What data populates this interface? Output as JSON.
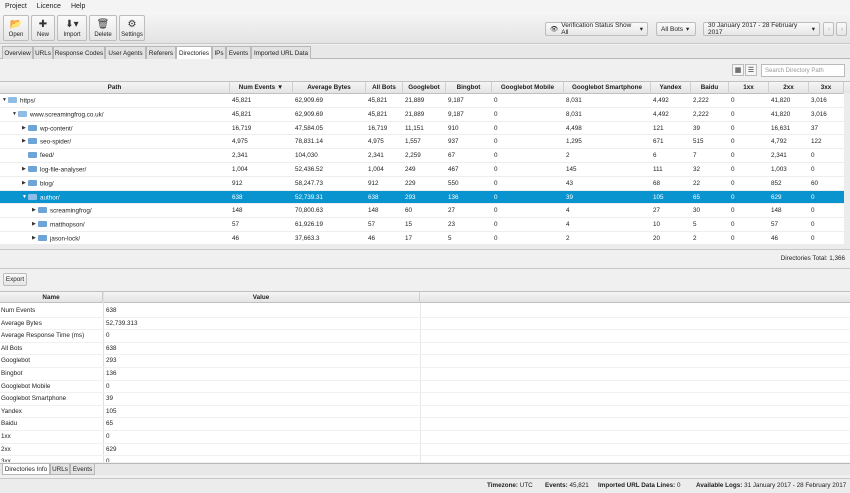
{
  "menu": [
    "Project",
    "Licence",
    "Help"
  ],
  "toolbar": {
    "open": "Open",
    "new": "New",
    "import": "Import",
    "delete": "Delete",
    "settings": "Settings",
    "verification": "Verification Status Show All",
    "bots": "All Bots",
    "daterange": "30 January 2017 - 28 February 2017"
  },
  "tabs": [
    "Overview",
    "URLs",
    "Response Codes",
    "User Agents",
    "Referers",
    "Directories",
    "IPs",
    "Events",
    "Imported URL Data"
  ],
  "search_placeholder": "Search Directory Path",
  "columns": [
    "Path",
    "Num Events",
    "Average Bytes",
    "All Bots",
    "Googlebot",
    "Bingbot",
    "Googlebot Mobile",
    "Googlebot Smartphone",
    "Yandex",
    "Baidu",
    "1xx",
    "2xx",
    "3xx"
  ],
  "rows": [
    {
      "path": "https/",
      "v": [
        "45,821",
        "62,909.69",
        "45,821",
        "21,889",
        "9,187",
        "0",
        "8,031",
        "4,492",
        "2,222",
        "0",
        "41,820",
        "3,016"
      ]
    },
    {
      "path": "www.screamingfrog.co.uk/",
      "v": [
        "45,821",
        "62,909.69",
        "45,821",
        "21,889",
        "9,187",
        "0",
        "8,031",
        "4,492",
        "2,222",
        "0",
        "41,820",
        "3,016"
      ]
    },
    {
      "path": "wp-content/",
      "v": [
        "16,719",
        "47,584.05",
        "16,719",
        "11,151",
        "910",
        "0",
        "4,498",
        "121",
        "39",
        "0",
        "16,631",
        "37"
      ]
    },
    {
      "path": "seo-spider/",
      "v": [
        "4,975",
        "78,831.14",
        "4,975",
        "1,557",
        "937",
        "0",
        "1,295",
        "671",
        "515",
        "0",
        "4,792",
        "122"
      ]
    },
    {
      "path": "feed/",
      "v": [
        "2,341",
        "104,030",
        "2,341",
        "2,259",
        "67",
        "0",
        "2",
        "6",
        "7",
        "0",
        "2,341",
        "0"
      ]
    },
    {
      "path": "log-file-analyser/",
      "v": [
        "1,004",
        "52,436.52",
        "1,004",
        "249",
        "467",
        "0",
        "145",
        "111",
        "32",
        "0",
        "1,003",
        "0"
      ]
    },
    {
      "path": "blog/",
      "v": [
        "912",
        "58,247.73",
        "912",
        "229",
        "550",
        "0",
        "43",
        "68",
        "22",
        "0",
        "852",
        "60"
      ]
    },
    {
      "path": "author/",
      "v": [
        "638",
        "52,739.31",
        "638",
        "293",
        "136",
        "0",
        "39",
        "105",
        "65",
        "0",
        "629",
        "0"
      ]
    },
    {
      "path": "screamingfrog/",
      "v": [
        "148",
        "70,800.63",
        "148",
        "60",
        "27",
        "0",
        "4",
        "27",
        "30",
        "0",
        "148",
        "0"
      ]
    },
    {
      "path": "matthopson/",
      "v": [
        "57",
        "61,926.19",
        "57",
        "15",
        "23",
        "0",
        "4",
        "10",
        "5",
        "0",
        "57",
        "0"
      ]
    },
    {
      "path": "jason-lock/",
      "v": [
        "46",
        "37,663.3",
        "46",
        "17",
        "5",
        "0",
        "2",
        "20",
        "2",
        "0",
        "46",
        "0"
      ]
    }
  ],
  "directories_total": "Directories Total: 1,366",
  "export_label": "Export",
  "detail": {
    "headers": [
      "Name",
      "Value"
    ],
    "rows": [
      {
        "k": "Num Events",
        "v": "638"
      },
      {
        "k": "Average Bytes",
        "v": "52,739.313"
      },
      {
        "k": "Average Response Time (ms)",
        "v": "0"
      },
      {
        "k": "All Bots",
        "v": "638"
      },
      {
        "k": "Googlebot",
        "v": "293"
      },
      {
        "k": "Bingbot",
        "v": "136"
      },
      {
        "k": "Googlebot Mobile",
        "v": "0"
      },
      {
        "k": "Googlebot Smartphone",
        "v": "39"
      },
      {
        "k": "Yandex",
        "v": "105"
      },
      {
        "k": "Baidu",
        "v": "65"
      },
      {
        "k": "1xx",
        "v": "0"
      },
      {
        "k": "2xx",
        "v": "629"
      },
      {
        "k": "3xx",
        "v": "0"
      }
    ]
  },
  "bottom_tabs": [
    "Directories Info",
    "URLs",
    "Events"
  ],
  "status": {
    "timezone_label": "Timezone:",
    "timezone": "UTC",
    "events_label": "Events:",
    "events": "45,821",
    "imported_label": "Imported URL Data Lines:",
    "imported": "0",
    "logs_label": "Available Logs:",
    "logs": "31 January 2017 - 28 February 2017"
  }
}
